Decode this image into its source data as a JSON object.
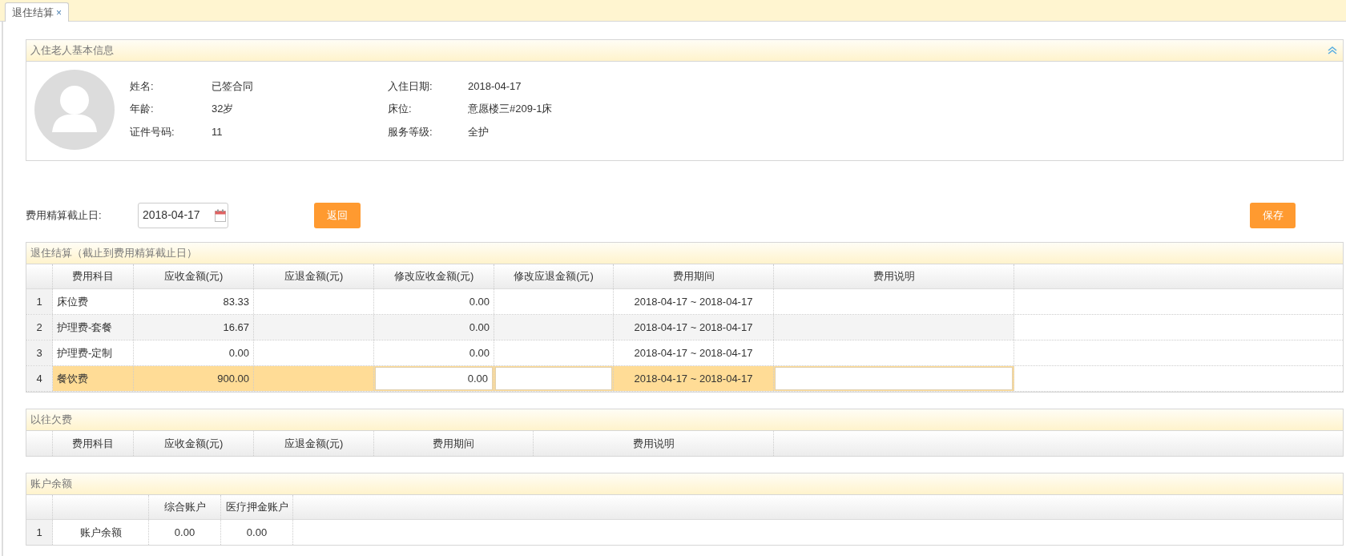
{
  "tabs": [
    {
      "label": "退住结算",
      "close": "×",
      "selected": true
    }
  ],
  "info_panel": {
    "title": "入住老人基本信息",
    "fields": [
      {
        "label": "姓名:",
        "value": "已签合同"
      },
      {
        "label": "入住日期:",
        "value": "2018-04-17"
      },
      {
        "label": "年龄:",
        "value": "32岁"
      },
      {
        "label": "床位:",
        "value": "意愿楼三#209-1床"
      },
      {
        "label": "证件号码:",
        "value": "11"
      },
      {
        "label": "服务等级:",
        "value": "全护"
      }
    ]
  },
  "cutoff": {
    "label": "费用精算截止日:",
    "value": "2018-04-17"
  },
  "buttons": {
    "back": "返回",
    "save": "保存"
  },
  "settlement": {
    "title": "退住结算（截止到费用精算截止日）",
    "columns": [
      "费用科目",
      "应收金额(元)",
      "应退金额(元)",
      "修改应收金额(元)",
      "修改应退金额(元)",
      "费用期间",
      "费用说明"
    ],
    "rows": [
      {
        "index": "1",
        "item": "床位费",
        "receivable": "83.33",
        "refund": "",
        "mod_receivable": "0.00",
        "mod_refund": "",
        "period": "2018-04-17 ~ 2018-04-17",
        "note": "",
        "selected": false
      },
      {
        "index": "2",
        "item": "护理费-套餐",
        "receivable": "16.67",
        "refund": "",
        "mod_receivable": "0.00",
        "mod_refund": "",
        "period": "2018-04-17 ~ 2018-04-17",
        "note": "",
        "selected": false
      },
      {
        "index": "3",
        "item": "护理费-定制",
        "receivable": "0.00",
        "refund": "",
        "mod_receivable": "0.00",
        "mod_refund": "",
        "period": "2018-04-17 ~ 2018-04-17",
        "note": "",
        "selected": false
      },
      {
        "index": "4",
        "item": "餐饮费",
        "receivable": "900.00",
        "refund": "",
        "mod_receivable": "0.00",
        "mod_refund": "",
        "period": "2018-04-17 ~ 2018-04-17",
        "note": "",
        "selected": true
      }
    ]
  },
  "arrears": {
    "title": "以往欠费",
    "columns": [
      "费用科目",
      "应收金额(元)",
      "应退金额(元)",
      "费用期间",
      "费用说明"
    ]
  },
  "balance": {
    "title": "账户余额",
    "columns": [
      "综合账户",
      "医疗押金账户"
    ],
    "rows": [
      {
        "index": "1",
        "name": "账户余额",
        "values": [
          "0.00",
          "0.00"
        ]
      }
    ]
  }
}
